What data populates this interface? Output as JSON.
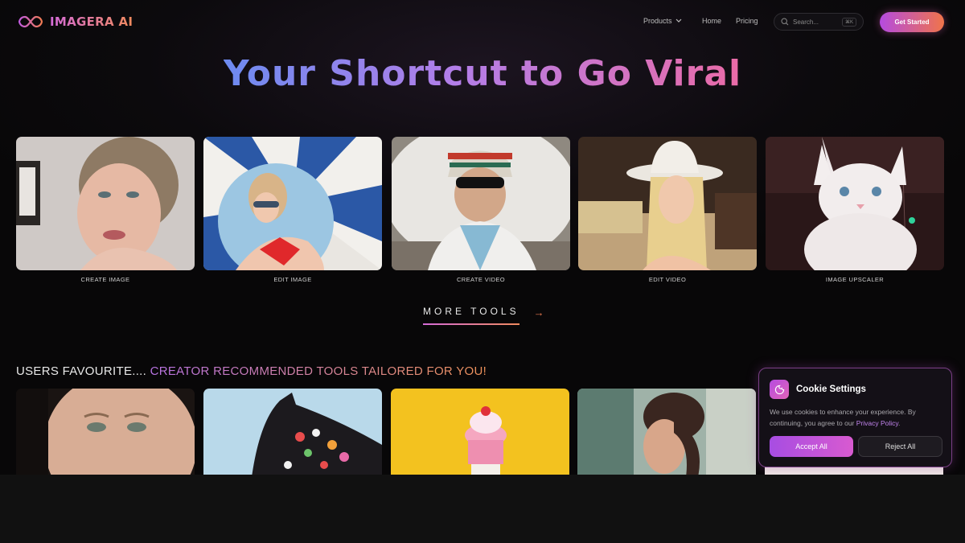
{
  "brand": {
    "name": "IMAGERA AI"
  },
  "nav": {
    "products": "Products",
    "home": "Home",
    "pricing": "Pricing"
  },
  "search": {
    "placeholder": "Search...",
    "shortcut": "⌘K"
  },
  "header": {
    "cta": "Get Started"
  },
  "hero": {
    "title": "Your Shortcut to Go Viral"
  },
  "tools": [
    {
      "label": "CREATE IMAGE"
    },
    {
      "label": "EDIT IMAGE"
    },
    {
      "label": "CREATE VIDEO"
    },
    {
      "label": "EDIT VIDEO"
    },
    {
      "label": "IMAGE UPSCALER"
    }
  ],
  "more_tools": {
    "label": "MORE TOOLS"
  },
  "favourites": {
    "title_part1": "USERS FAVOURITE....",
    "title_part2": " CREATOR RECOMMENDED TOOLS TAILORED FOR YOU!"
  },
  "cookie": {
    "title": "Cookie Settings",
    "text": "We use cookies to enhance your experience. By continuing, you agree to our ",
    "link": "Privacy Policy",
    "text_end": ".",
    "accept": "Accept All",
    "reject": "Reject All"
  },
  "colors": {
    "accent_purple": "#b54be0",
    "accent_orange": "#f0744a",
    "background": "#0c0a0d"
  }
}
